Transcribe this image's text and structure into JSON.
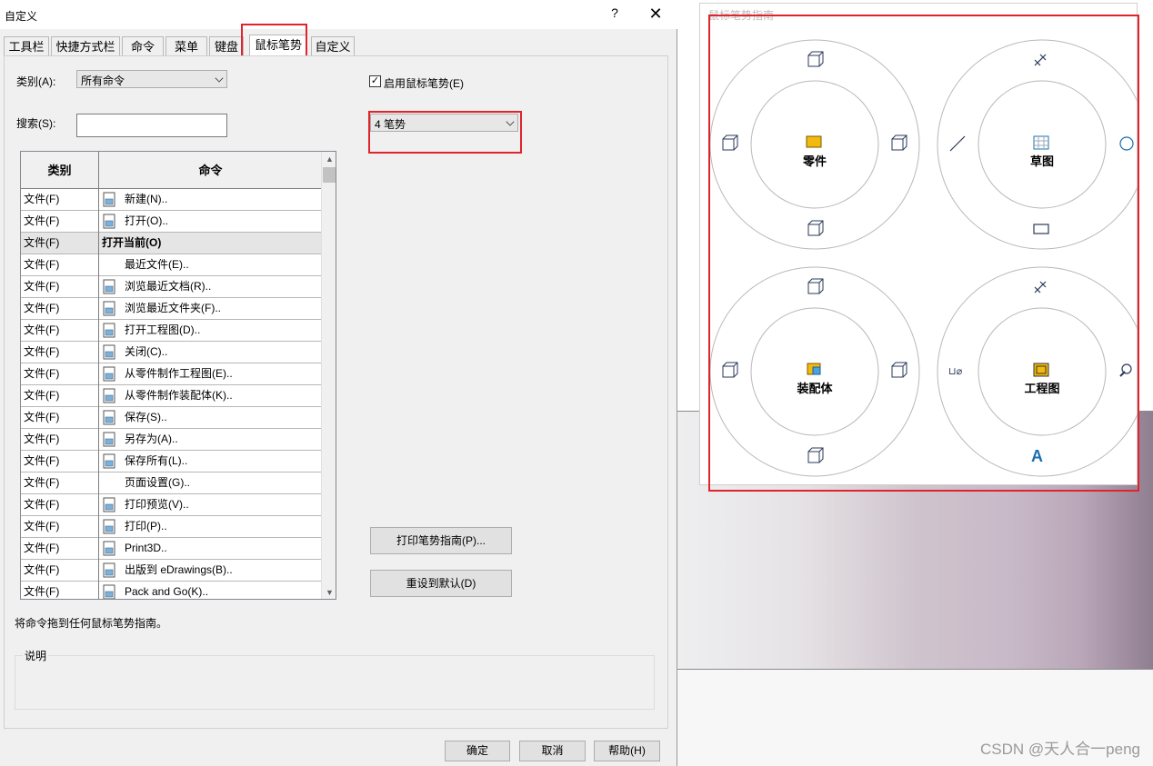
{
  "dialog": {
    "title": "自定义",
    "help": "?",
    "close": "✕",
    "tabs": [
      "工具栏",
      "快捷方式栏",
      "命令",
      "菜单",
      "键盘",
      "鼠标笔势",
      "自定义"
    ],
    "active_tab": "鼠标笔势",
    "category_label": "类别(A):",
    "category_value": "所有命令",
    "search_label": "搜索(S):",
    "search_value": "",
    "enable_label": "启用鼠标笔势(E)",
    "enable_checked": true,
    "gesture_count_value": "4 笔势",
    "print_button": "打印笔势指南(P)...",
    "reset_button": "重设到默认(D)",
    "drag_hint": "将命令拖到任何鼠标笔势指南。",
    "description_label": "说明",
    "ok": "确定",
    "cancel": "取消",
    "help_button": "帮助(H)"
  },
  "table": {
    "headers": [
      "类别",
      "命令"
    ],
    "rows": [
      {
        "cat": "文件(F)",
        "cmd": "新建(N)..",
        "icon": "new-doc-icon"
      },
      {
        "cat": "文件(F)",
        "cmd": "打开(O)..",
        "icon": "open-icon"
      },
      {
        "cat": "文件(F)",
        "cmd": "打开当前(O)",
        "icon": "",
        "selected": true
      },
      {
        "cat": "文件(F)",
        "cmd": "最近文件(E)..",
        "icon": ""
      },
      {
        "cat": "文件(F)",
        "cmd": "浏览最近文档(R)..",
        "icon": "recent-docs-icon"
      },
      {
        "cat": "文件(F)",
        "cmd": "浏览最近文件夹(F)..",
        "icon": "recent-folder-icon"
      },
      {
        "cat": "文件(F)",
        "cmd": "打开工程图(D)..",
        "icon": "open-drawing-icon"
      },
      {
        "cat": "文件(F)",
        "cmd": "关闭(C)..",
        "icon": "close-doc-icon"
      },
      {
        "cat": "文件(F)",
        "cmd": "从零件制作工程图(E)..",
        "icon": "make-drawing-icon"
      },
      {
        "cat": "文件(F)",
        "cmd": "从零件制作装配体(K)..",
        "icon": "make-assembly-icon"
      },
      {
        "cat": "文件(F)",
        "cmd": "保存(S)..",
        "icon": "save-icon"
      },
      {
        "cat": "文件(F)",
        "cmd": "另存为(A)..",
        "icon": "save-as-icon"
      },
      {
        "cat": "文件(F)",
        "cmd": "保存所有(L)..",
        "icon": "save-all-icon"
      },
      {
        "cat": "文件(F)",
        "cmd": "页面设置(G)..",
        "icon": ""
      },
      {
        "cat": "文件(F)",
        "cmd": "打印预览(V)..",
        "icon": "print-preview-icon"
      },
      {
        "cat": "文件(F)",
        "cmd": "打印(P)..",
        "icon": "print-icon"
      },
      {
        "cat": "文件(F)",
        "cmd": "Print3D..",
        "icon": "print3d-icon"
      },
      {
        "cat": "文件(F)",
        "cmd": "出版到 eDrawings(B)..",
        "icon": "edrawings-icon"
      },
      {
        "cat": "文件(F)",
        "cmd": "Pack and Go(K)..",
        "icon": "pack-and-go-icon"
      }
    ]
  },
  "guide": {
    "title": "鼠标笔势指南",
    "wheels": [
      {
        "label": "零件",
        "center_icon": "part-icon"
      },
      {
        "label": "草图",
        "center_icon": "sketch-icon"
      },
      {
        "label": "装配体",
        "center_icon": "assembly-icon"
      },
      {
        "label": "工程图",
        "center_icon": "drawing-icon"
      }
    ]
  },
  "watermark": "CSDN @天人合一peng"
}
